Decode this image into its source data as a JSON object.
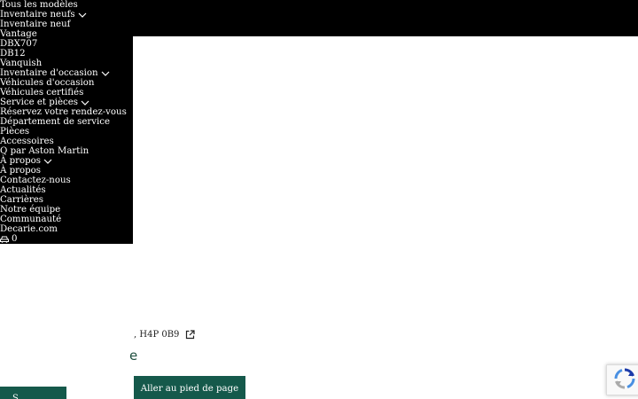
{
  "menu": {
    "items": [
      {
        "label": "Tous les modèles",
        "chevron": false
      },
      {
        "label": "Inventaire neufs",
        "chevron": true
      },
      {
        "label": "Inventaire neuf",
        "chevron": false
      },
      {
        "label": "Vantage",
        "chevron": false
      },
      {
        "label": "DBX707",
        "chevron": false
      },
      {
        "label": "DB12",
        "chevron": false
      },
      {
        "label": "Vanquish",
        "chevron": false
      },
      {
        "label": "Inventaire d'occasion",
        "chevron": true
      },
      {
        "label": "Véhicules d'occasion",
        "chevron": false
      },
      {
        "label": "Véhicules certifiés",
        "chevron": false
      },
      {
        "label": "Service et pièces",
        "chevron": true
      },
      {
        "label": "Réservez votre rendez-vous",
        "chevron": false
      },
      {
        "label": "Département de service",
        "chevron": false
      },
      {
        "label": "Pièces",
        "chevron": false
      },
      {
        "label": "Accessoires",
        "chevron": false
      },
      {
        "label": "Q par Aston Martin",
        "chevron": false
      },
      {
        "label": "À propos",
        "chevron": true
      },
      {
        "label": "À propos",
        "chevron": false
      },
      {
        "label": "Contactez-nous",
        "chevron": false
      },
      {
        "label": "Actualités",
        "chevron": false
      },
      {
        "label": "Carrières",
        "chevron": false
      },
      {
        "label": "Notre équipe",
        "chevron": false
      },
      {
        "label": "Communauté",
        "chevron": false
      },
      {
        "label": "Decarie.com",
        "chevron": false
      }
    ],
    "garage": {
      "icon": "car-icon",
      "count": "0"
    }
  },
  "address": {
    "text": ", H4P 0B9",
    "icon": "external-link-icon"
  },
  "partial_heading": "e",
  "skip_footer_label": "Aller au pied de page",
  "skip_left_label": "S",
  "recaptcha": {
    "icon": "recaptcha-icon"
  },
  "colors": {
    "menu_bg": "#000000",
    "button_bg": "#15594b",
    "text_dark": "#222222"
  }
}
